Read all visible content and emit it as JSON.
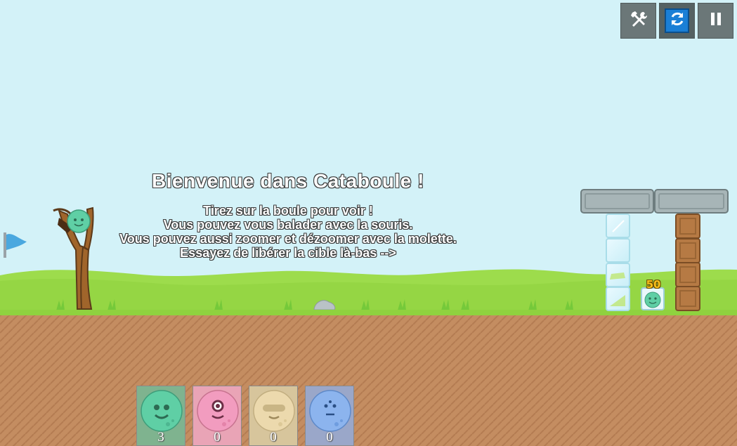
{
  "game": {
    "title": "Bienvenue dans Cataboule !",
    "instructions": [
      "Tirez sur la boule pour voir !",
      "Vous pouvez vous balader avec la souris.",
      "Vous pouvez aussi zoomer et dézoomer avec la molette.",
      "Essayez de libérer la cible là-bas -->"
    ],
    "target_score": "50"
  },
  "toolbar": {
    "tools_icon": "hammer-wrench-icon",
    "reset_icon": "refresh-icon",
    "pause_icon": "pause-icon"
  },
  "ball_inventory": [
    {
      "type": "green-ball",
      "count": "3",
      "color": "#5fcfa5",
      "card_color": "#7fb38f"
    },
    {
      "type": "pink-ball",
      "count": "0",
      "color": "#f29cbf",
      "card_color": "#e9a4b6"
    },
    {
      "type": "beige-ball",
      "count": "0",
      "color": "#ecd9ad",
      "card_color": "#d7c59c"
    },
    {
      "type": "blue-ball",
      "count": "0",
      "color": "#8cb4ee",
      "card_color": "#9aa7c9"
    }
  ],
  "colors": {
    "sky": "#d3f2f8",
    "grass": "#9ddc4c",
    "dirt": "#c48d61",
    "flag": "#4aa8df"
  }
}
